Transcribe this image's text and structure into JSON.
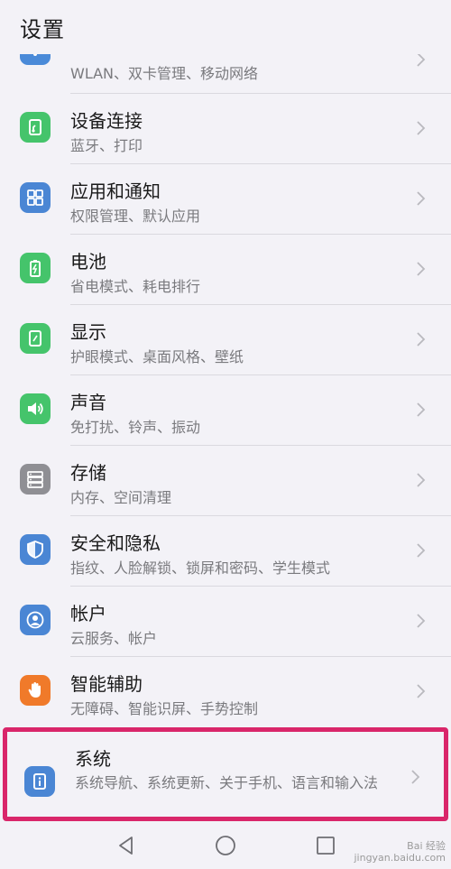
{
  "header": {
    "title": "设置"
  },
  "items": [
    {
      "label": "",
      "sub": "WLAN、双卡管理、移动网络",
      "icon": "wifi-icon",
      "color": "#4a8ad8"
    },
    {
      "label": "设备连接",
      "sub": "蓝牙、打印",
      "icon": "device-connection-icon",
      "color": "#45c46b"
    },
    {
      "label": "应用和通知",
      "sub": "权限管理、默认应用",
      "icon": "apps-grid-icon",
      "color": "#4a86d4"
    },
    {
      "label": "电池",
      "sub": "省电模式、耗电排行",
      "icon": "battery-icon",
      "color": "#45c46b"
    },
    {
      "label": "显示",
      "sub": "护眼模式、桌面风格、壁纸",
      "icon": "display-icon",
      "color": "#45c46b"
    },
    {
      "label": "声音",
      "sub": "免打扰、铃声、振动",
      "icon": "speaker-icon",
      "color": "#45c46b"
    },
    {
      "label": "存储",
      "sub": "内存、空间清理",
      "icon": "storage-icon",
      "color": "#8f8f94"
    },
    {
      "label": "安全和隐私",
      "sub": "指纹、人脸解锁、锁屏和密码、学生模式",
      "icon": "shield-icon",
      "color": "#4a86d4"
    },
    {
      "label": "帐户",
      "sub": "云服务、帐户",
      "icon": "account-icon",
      "color": "#4a86d4"
    },
    {
      "label": "智能辅助",
      "sub": "无障碍、智能识屏、手势控制",
      "icon": "hand-icon",
      "color": "#f07a2a"
    },
    {
      "label": "系统",
      "sub": "系统导航、系统更新、关于手机、语言和输入法",
      "icon": "system-info-icon",
      "color": "#4a86d4"
    }
  ],
  "highlight_color": "#d9266a",
  "watermark": {
    "line1": "Bai 经验",
    "line2": "jingyan.baidu.com"
  }
}
